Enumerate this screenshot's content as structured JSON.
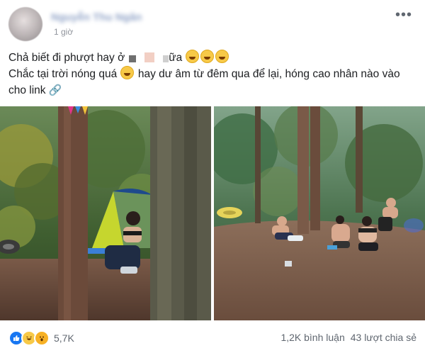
{
  "post": {
    "author": "Nguyễn Thu Ngân",
    "time": "1 giờ",
    "more_label": "•••",
    "line1_start": "Chả biết đi phượt hay ở",
    "line1_end": "ữa",
    "line2_start": "Chắc tại trời nóng quá",
    "line2_end": "hay dư âm từ đêm qua để lại, hóng cao nhân nào vào cho link",
    "link_icon": "🔗",
    "reaction_count": "5,7K",
    "comments": "1,2K bình luận",
    "shares": "43 lượt chia sẻ"
  },
  "icons": {
    "avatar": "avatar",
    "more": "more-icon",
    "grin": "grinning-emoji",
    "link": "link-icon",
    "like": "like-reaction-icon",
    "haha": "haha-reaction-icon",
    "wow": "wow-reaction-icon"
  },
  "colors": {
    "link_blue": "#365899",
    "meta_gray": "#606770",
    "like_blue": "#1877f2"
  }
}
